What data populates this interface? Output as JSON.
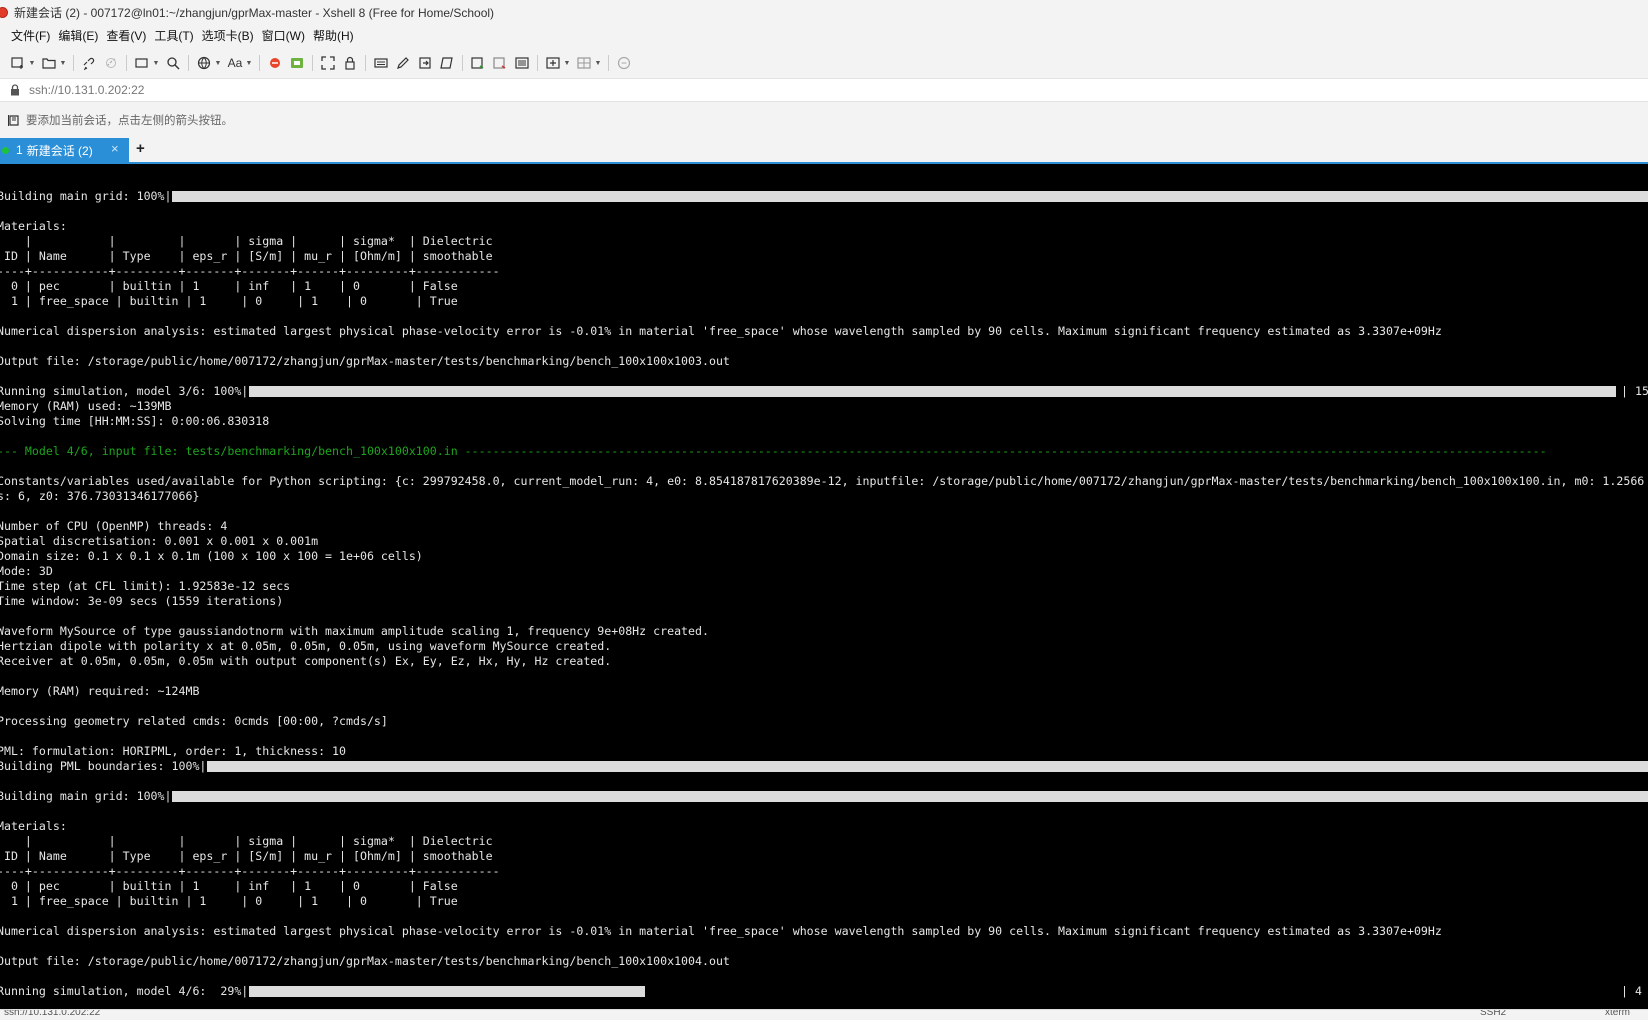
{
  "window": {
    "title": "新建会话 (2) - 007172@ln01:~/zhangjun/gprMax-master - Xshell 8 (Free for Home/School)"
  },
  "menu": [
    "文件(F)",
    "编辑(E)",
    "查看(V)",
    "工具(T)",
    "选项卡(B)",
    "窗口(W)",
    "帮助(H)"
  ],
  "toolbar": {
    "font_label": "Aa"
  },
  "address": {
    "url": "ssh://10.131.0.202:22"
  },
  "hint": {
    "text": "要添加当前会话，点击左侧的箭头按钮。"
  },
  "tabs": [
    {
      "index": "1",
      "label": "新建会话 (2)",
      "close": "×"
    }
  ],
  "tab_add": "+",
  "terminal": {
    "lines": [
      {
        "text": "Building main grid: 100%|",
        "bar": "full"
      },
      {
        "text": ""
      },
      {
        "text": "Materials:"
      },
      {
        "text": "    |           |         |       | sigma |      | sigma*  | Dielectric"
      },
      {
        "text": " ID | Name      | Type    | eps_r | [S/m] | mu_r | [Ohm/m] | smoothable"
      },
      {
        "text": "----+-----------+---------+-------+-------+------+---------+------------"
      },
      {
        "text": "  0 | pec       | builtin | 1     | inf   | 1    | 0       | False"
      },
      {
        "text": "  1 | free_space | builtin | 1     | 0     | 1    | 0       | True"
      },
      {
        "text": ""
      },
      {
        "text": "Numerical dispersion analysis: estimated largest physical phase-velocity error is -0.01% in material 'free_space' whose wavelength sampled by 90 cells. Maximum significant frequency estimated as 3.3307e+09Hz"
      },
      {
        "text": ""
      },
      {
        "text": "Output file: /storage/public/home/007172/zhangjun/gprMax-master/tests/benchmarking/bench_100x100x1003.out"
      },
      {
        "text": ""
      },
      {
        "text": "Running simulation, model 3/6: 100%|",
        "bar": "sim",
        "suffix": "| 15"
      },
      {
        "text": "Memory (RAM) used: ~139MB"
      },
      {
        "text": "Solving time [HH:MM:SS]: 0:00:06.830318"
      },
      {
        "text": ""
      },
      {
        "text": "--- Model 4/6, input file: tests/benchmarking/bench_100x100x100.in -----------------------------------------------------------------------------------------------------------------------------------------------------------",
        "green": true
      },
      {
        "text": ""
      },
      {
        "text": "Constants/variables used/available for Python scripting: {c: 299792458.0, current_model_run: 4, e0: 8.854187817620389e-12, inputfile: /storage/public/home/007172/zhangjun/gprMax-master/tests/benchmarking/bench_100x100x100.in, m0: 1.2566"
      },
      {
        "text": "s: 6, z0: 376.73031346177066}"
      },
      {
        "text": ""
      },
      {
        "text": "Number of CPU (OpenMP) threads: 4"
      },
      {
        "text": "Spatial discretisation: 0.001 x 0.001 x 0.001m"
      },
      {
        "text": "Domain size: 0.1 x 0.1 x 0.1m (100 x 100 x 100 = 1e+06 cells)"
      },
      {
        "text": "Mode: 3D"
      },
      {
        "text": "Time step (at CFL limit): 1.92583e-12 secs"
      },
      {
        "text": "Time window: 3e-09 secs (1559 iterations)"
      },
      {
        "text": ""
      },
      {
        "text": "Waveform MySource of type gaussiandotnorm with maximum amplitude scaling 1, frequency 9e+08Hz created."
      },
      {
        "text": "Hertzian dipole with polarity x at 0.05m, 0.05m, 0.05m, using waveform MySource created."
      },
      {
        "text": "Receiver at 0.05m, 0.05m, 0.05m with output component(s) Ex, Ey, Ez, Hx, Hy, Hz created."
      },
      {
        "text": ""
      },
      {
        "text": "Memory (RAM) required: ~124MB"
      },
      {
        "text": ""
      },
      {
        "text": "Processing geometry related cmds: 0cmds [00:00, ?cmds/s]"
      },
      {
        "text": ""
      },
      {
        "text": "PML: formulation: HORIPML, order: 1, thickness: 10"
      },
      {
        "text": "Building PML boundaries: 100%|",
        "bar": "full"
      },
      {
        "text": ""
      },
      {
        "text": "Building main grid: 100%|",
        "bar": "full"
      },
      {
        "text": ""
      },
      {
        "text": "Materials:"
      },
      {
        "text": "    |           |         |       | sigma |      | sigma*  | Dielectric"
      },
      {
        "text": " ID | Name      | Type    | eps_r | [S/m] | mu_r | [Ohm/m] | smoothable"
      },
      {
        "text": "----+-----------+---------+-------+-------+------+---------+------------"
      },
      {
        "text": "  0 | pec       | builtin | 1     | inf   | 1    | 0       | False"
      },
      {
        "text": "  1 | free_space | builtin | 1     | 0     | 1    | 0       | True"
      },
      {
        "text": ""
      },
      {
        "text": "Numerical dispersion analysis: estimated largest physical phase-velocity error is -0.01% in material 'free_space' whose wavelength sampled by 90 cells. Maximum significant frequency estimated as 3.3307e+09Hz"
      },
      {
        "text": ""
      },
      {
        "text": "Output file: /storage/public/home/007172/zhangjun/gprMax-master/tests/benchmarking/bench_100x100x1004.out"
      },
      {
        "text": ""
      },
      {
        "text": "Running simulation, model 4/6:  29%|",
        "bar": "partial",
        "progress": 0.29,
        "suffix": "| 4"
      }
    ]
  },
  "status": {
    "left": "ssh://10.131.0.202:22",
    "right": "SSH2",
    "right2": "xterm"
  }
}
